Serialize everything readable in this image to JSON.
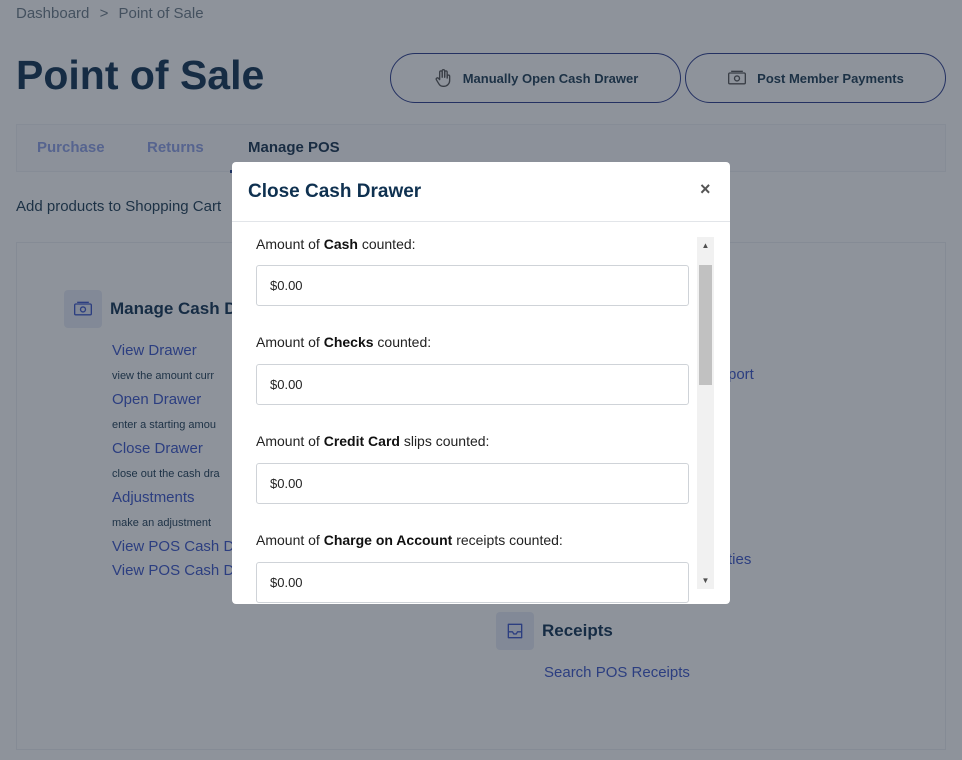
{
  "breadcrumb": {
    "home": "Dashboard",
    "separator": ">",
    "current": "Point of Sale"
  },
  "page_title": "Point of Sale",
  "header_buttons": {
    "open_drawer": "Manually Open Cash Drawer",
    "post_payments": "Post Member Payments"
  },
  "tabs": [
    {
      "label": "Purchase",
      "active": false
    },
    {
      "label": "Returns",
      "active": false
    },
    {
      "label": "Manage POS",
      "active": true
    }
  ],
  "hint": "Add products to Shopping Cart",
  "cash_section": {
    "title": "Manage Cash D",
    "links": [
      {
        "label": "View Drawer",
        "desc": "view the amount curr"
      },
      {
        "label": "Open Drawer",
        "desc": "enter a starting amou"
      },
      {
        "label": "Close Drawer",
        "desc": "close out the cash dra"
      },
      {
        "label": "Adjustments",
        "desc": "make an adjustment"
      }
    ],
    "extra_links": [
      "View POS Cash D",
      "View POS Cash D"
    ]
  },
  "right_partial": {
    "report": "port",
    "entities": "ties"
  },
  "receipts_section": {
    "title": "Receipts",
    "link": "Search POS Receipts"
  },
  "modal": {
    "title": "Close Cash Drawer",
    "close": "×",
    "fields": [
      {
        "prefix": "Amount of ",
        "strong": "Cash",
        "suffix": " counted:",
        "value": "$0.00"
      },
      {
        "prefix": "Amount of ",
        "strong": "Checks",
        "suffix": " counted:",
        "value": "$0.00"
      },
      {
        "prefix": "Amount of ",
        "strong": "Credit Card",
        "suffix": " slips counted:",
        "value": "$0.00"
      },
      {
        "prefix": "Amount of ",
        "strong": "Charge on Account",
        "suffix": " receipts counted:",
        "value": "$0.00"
      }
    ],
    "scroll_up": "▲",
    "scroll_down": "▼"
  }
}
